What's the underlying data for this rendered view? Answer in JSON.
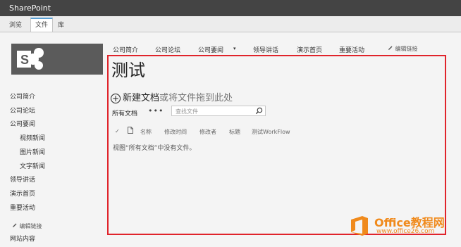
{
  "suite_bar": {
    "title": "SharePoint"
  },
  "ribbon": {
    "tabs": [
      "浏览",
      "文件",
      "库"
    ]
  },
  "top_nav": {
    "items": [
      "公司简介",
      "公司论坛",
      "公司要闻",
      "领导讲话",
      "演示首页",
      "重要活动"
    ],
    "caret": "▾",
    "edit_links": "编辑链接"
  },
  "quick_launch": {
    "items": [
      "公司简介",
      "公司论坛",
      "公司要闻",
      "视频新闻",
      "图片新闻",
      "文字新闻",
      "领导讲话",
      "演示首页",
      "重要活动"
    ],
    "edit_links": "编辑链接",
    "site_contents": "网站内容"
  },
  "main": {
    "title": "测试",
    "new_doc_link": "新建文档",
    "new_doc_rest": "或将文件拖到此处",
    "view_name": "所有文档",
    "more": "•••",
    "search_placeholder": "查找文件",
    "columns": [
      "✓",
      "名称",
      "修改时间",
      "修改者",
      "标题",
      "测试WorkFlow"
    ],
    "empty_message": "视图“所有文档”中没有文件。"
  },
  "watermark": {
    "brand": "Office教程网",
    "url": "www.office26.com"
  },
  "colors": {
    "suite_bar": "#444444",
    "highlight_border": "#e0242b",
    "watermark": "#f08a1c",
    "tab_accent": "#5aa0d4"
  },
  "icons": {
    "new_doc": "plus-circle-icon",
    "search": "search-icon",
    "edit": "pencil-icon",
    "doc": "document-icon"
  }
}
